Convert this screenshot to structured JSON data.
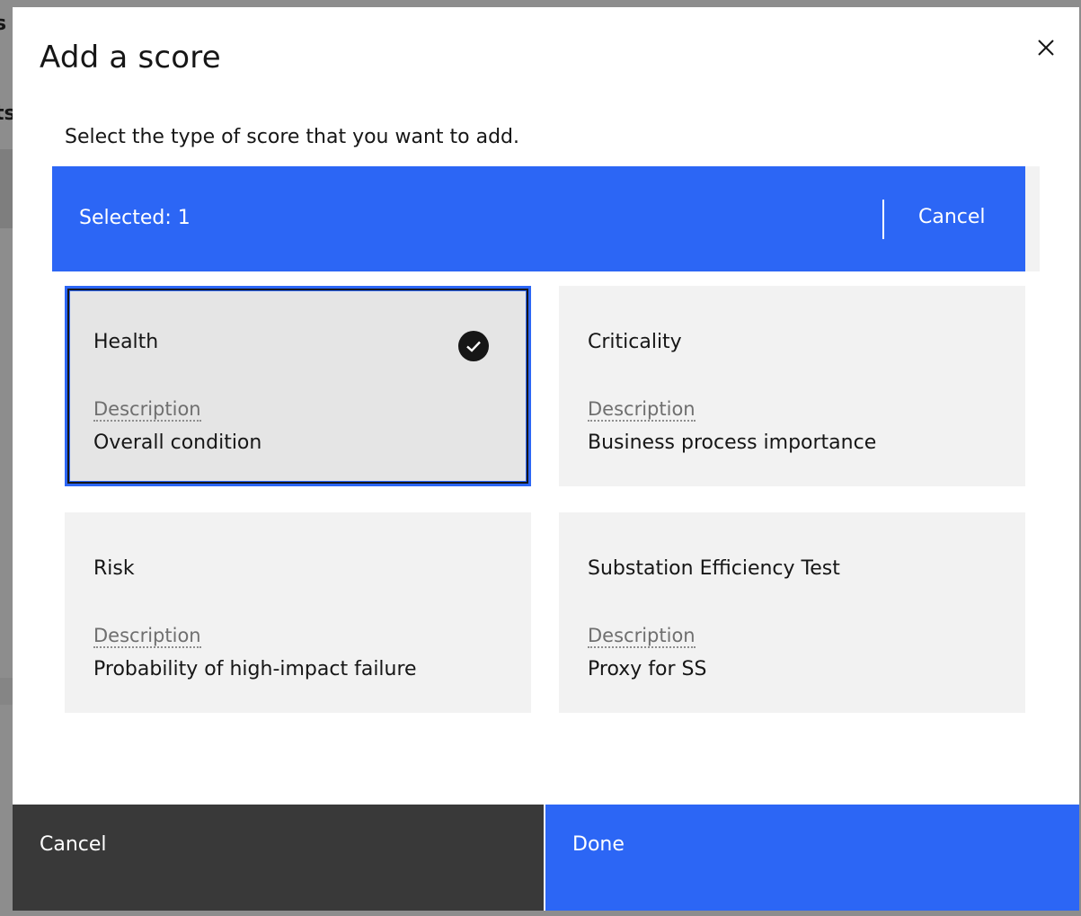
{
  "background": {
    "fragments": [
      "s",
      "ts"
    ]
  },
  "modal": {
    "title": "Add a score",
    "close_icon": "close-icon",
    "subtitle": "Select the type of score that you want to add."
  },
  "batch_bar": {
    "count_label": "Selected: 1",
    "cancel_label": "Cancel",
    "accent": "#2c66f5"
  },
  "tiles": [
    {
      "name": "Health",
      "desc_label": "Description",
      "desc_value": "Overall condition",
      "selected": true
    },
    {
      "name": "Criticality",
      "desc_label": "Description",
      "desc_value": "Business process importance",
      "selected": false
    },
    {
      "name": "Risk",
      "desc_label": "Description",
      "desc_value": "Probability of high-impact failure",
      "selected": false
    },
    {
      "name": "Substation Efficiency Test",
      "desc_label": "Description",
      "desc_value": "Proxy for SS",
      "selected": false
    }
  ],
  "footer": {
    "cancel_label": "Cancel",
    "done_label": "Done"
  }
}
